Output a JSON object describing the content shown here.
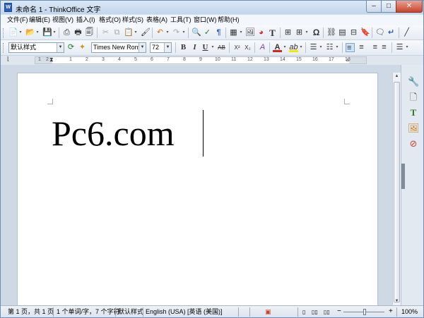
{
  "window": {
    "title": "未命名 1 - ThinkOffice 文字",
    "app_icon_label": "W",
    "minimize_glyph": "–",
    "maximize_glyph": "□",
    "close_glyph": "✕"
  },
  "menu": [
    "文件(F)",
    "编辑(E)",
    "视图(V)",
    "插入(I)",
    "格式(O)",
    "样式(S)",
    "表格(A)",
    "工具(T)",
    "窗口(W)",
    "帮助(H)"
  ],
  "toolbar1_icons": [
    {
      "name": "new-document-icon",
      "glyph": "📄"
    },
    {
      "name": "new-dropdown-icon",
      "glyph": "▾"
    },
    {
      "name": "open-folder-icon",
      "glyph": "📂"
    },
    {
      "name": "open-dropdown-icon",
      "glyph": "▾"
    },
    {
      "name": "save-icon",
      "glyph": "💾"
    },
    {
      "name": "save-dropdown-icon",
      "glyph": "▾"
    },
    {
      "name": "export-pdf-icon",
      "glyph": "⎙"
    },
    {
      "name": "print-icon",
      "glyph": "🖶"
    },
    {
      "name": "print-preview-icon",
      "glyph": "🗐"
    },
    {
      "name": "cut-icon",
      "glyph": "✂"
    },
    {
      "name": "copy-icon",
      "glyph": "⧉"
    },
    {
      "name": "paste-icon",
      "glyph": "📋"
    },
    {
      "name": "paste-dropdown-icon",
      "glyph": "▾"
    },
    {
      "name": "format-paintbrush-icon",
      "glyph": "🖌"
    },
    {
      "name": "undo-icon",
      "glyph": "↶"
    },
    {
      "name": "undo-dropdown-icon",
      "glyph": "▾"
    },
    {
      "name": "redo-icon",
      "glyph": "↷"
    },
    {
      "name": "redo-dropdown-icon",
      "glyph": "▾"
    },
    {
      "name": "find-replace-icon",
      "glyph": "🔍"
    },
    {
      "name": "spellcheck-icon",
      "glyph": "✓"
    },
    {
      "name": "formatting-marks-icon",
      "glyph": "¶"
    },
    {
      "name": "insert-table-icon",
      "glyph": "▦"
    },
    {
      "name": "insert-table-dropdown-icon",
      "glyph": "▾"
    },
    {
      "name": "insert-image-icon",
      "glyph": "🖼"
    },
    {
      "name": "insert-chart-icon",
      "glyph": "◕"
    },
    {
      "name": "insert-textbox-icon",
      "glyph": "T"
    },
    {
      "name": "insert-field-icon",
      "glyph": "⊞"
    },
    {
      "name": "insert-field-dropdown-icon",
      "glyph": "▾"
    },
    {
      "name": "special-character-icon",
      "glyph": "Ω"
    },
    {
      "name": "insert-link-icon",
      "glyph": "⛓"
    },
    {
      "name": "footnote-icon",
      "glyph": "▤"
    },
    {
      "name": "page-break-icon",
      "glyph": "⊟"
    },
    {
      "name": "bookmark-icon",
      "glyph": "🔖"
    },
    {
      "name": "comment-icon",
      "glyph": "🗨"
    },
    {
      "name": "cross-reference-icon",
      "glyph": "↵"
    },
    {
      "name": "track-changes-icon",
      "glyph": "⊕"
    },
    {
      "name": "draw-line-icon",
      "glyph": "╱"
    }
  ],
  "toolbar2": {
    "paragraph_style": "默认样式",
    "font_name": "Times New Roman",
    "font_size": "72",
    "update_style_icon": "⟳",
    "new_style_icon": "✦",
    "bold": "B",
    "italic": "I",
    "underline": "U",
    "strikethrough": "AB",
    "superscript": "X²",
    "subscript": "X₂",
    "clear_format": "A",
    "font_color": "A",
    "highlight": "ab",
    "font_color_hex": "#d9261c",
    "highlight_hex": "#f5e600",
    "align_icons": [
      "≡",
      "≡",
      "≡",
      "≡"
    ]
  },
  "ruler_numbers": [
    "1",
    "2",
    "1",
    "2",
    "3",
    "4",
    "5",
    "6",
    "7",
    "8",
    "9",
    "10",
    "11",
    "12",
    "13",
    "14",
    "15",
    "16",
    "17",
    "18"
  ],
  "document": {
    "text": "Pc6.com"
  },
  "statusbar": {
    "page": "第 1 页，共 1 页",
    "word_count": "1 个单词/字，7 个字符",
    "page_style": "默认样式",
    "language": "English (USA) [英语 (美国)]",
    "zoom_minus": "−",
    "zoom_plus": "+",
    "zoom_level": "100%"
  },
  "accent_color": "#6d8fb3"
}
